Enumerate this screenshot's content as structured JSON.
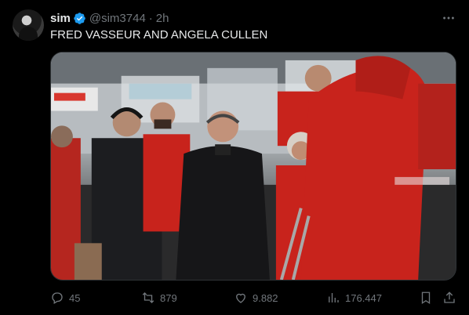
{
  "post": {
    "author_name": "sim",
    "handle": "@sim3744",
    "separator": "·",
    "time": "2h",
    "text": "FRED VASSEUR AND ANGELA CULLEN",
    "more_icon": "more-horizontal-icon"
  },
  "metrics": {
    "replies": "45",
    "reposts": "879",
    "likes": "9.882",
    "views": "176.447"
  },
  "colors": {
    "background": "#000000",
    "text": "#e7e9ea",
    "muted": "#71767b",
    "verified": "#1d9bf0",
    "ferrari_red": "#c8231c"
  }
}
